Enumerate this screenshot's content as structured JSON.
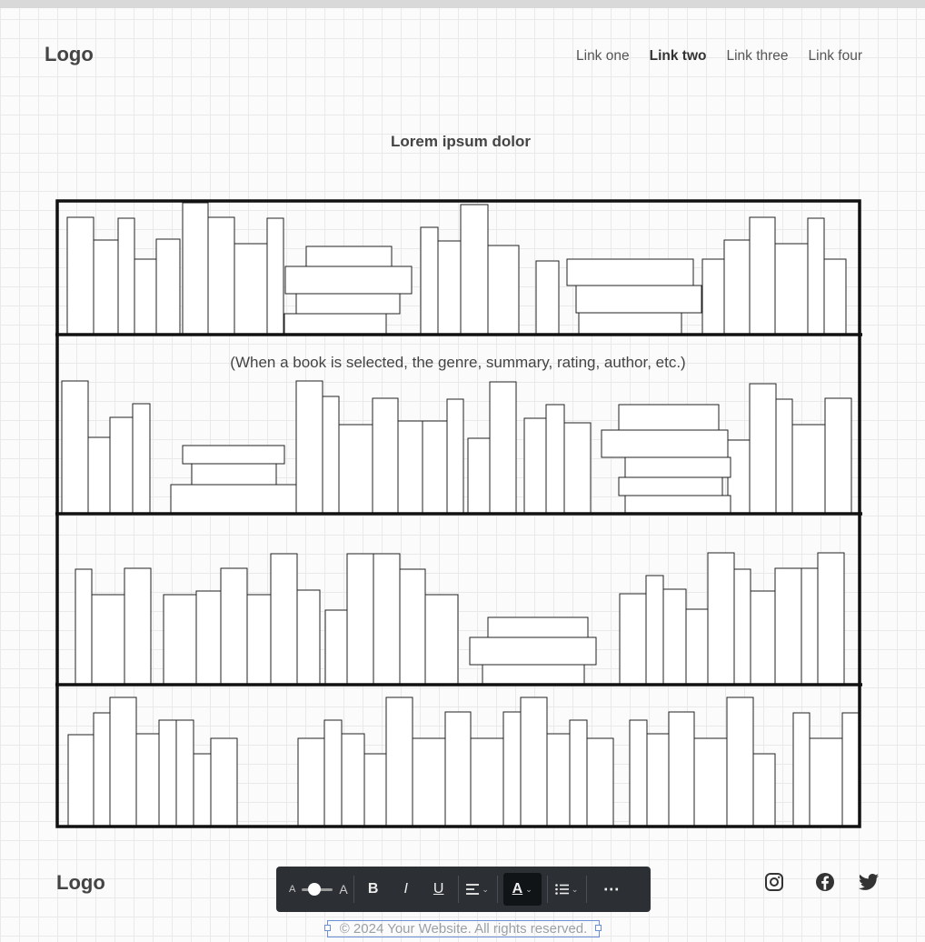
{
  "header": {
    "logo": "Logo",
    "nav": [
      "Link one",
      "Link two",
      "Link three",
      "Link four"
    ],
    "active_nav": "Link two"
  },
  "main": {
    "heading": "Lorem ipsum dolor",
    "caption": "(When a book is selected, the genre, summary, rating, author, etc.)"
  },
  "footer": {
    "logo": "Logo",
    "copyright": "© 2024 Your Website. All rights reserved.",
    "social_icons": [
      "instagram-icon",
      "facebook-icon",
      "twitter-icon"
    ]
  },
  "toolbar": {
    "font_small_glyph": "A",
    "font_large_glyph": "A",
    "bold": "B",
    "italic": "I",
    "underline": "U",
    "text_color_glyph": "A",
    "more": "⋯",
    "icons": [
      "text-size-slider",
      "bold-icon",
      "italic-icon",
      "underline-icon",
      "align-left-icon",
      "text-color-icon",
      "list-icon",
      "more-icon"
    ]
  },
  "colors": {
    "toolbar_bg": "#2c3034",
    "selection": "#6b8fd6",
    "ink": "#111111"
  }
}
